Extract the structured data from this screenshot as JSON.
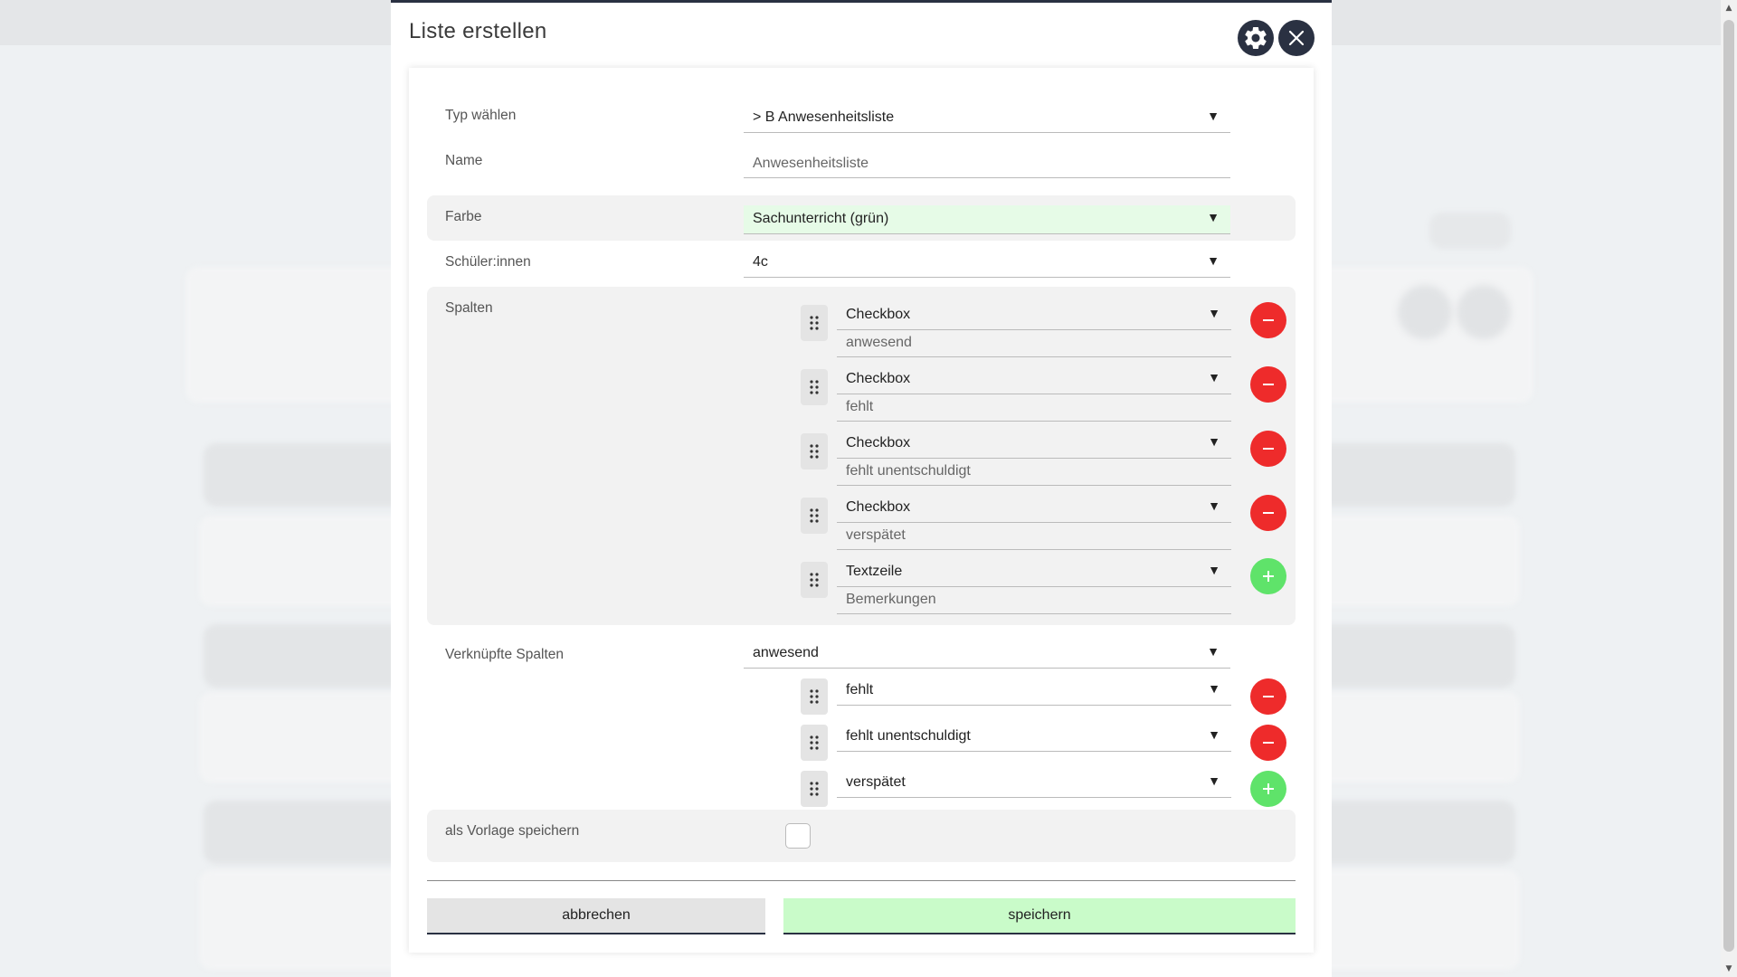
{
  "dialog": {
    "title": "Liste erstellen",
    "settings_icon": "gear-icon",
    "close_icon": "close-icon"
  },
  "form": {
    "type": {
      "label": "Typ wählen",
      "value": "> B Anwesenheitsliste"
    },
    "name": {
      "label": "Name",
      "value": "Anwesenheitsliste"
    },
    "color": {
      "label": "Farbe",
      "value": "Sachunterricht (grün)",
      "highlight": "#e6fbe7"
    },
    "students": {
      "label": "Schüler:innen",
      "value": "4c"
    },
    "columns": {
      "label": "Spalten",
      "items": [
        {
          "type": "Checkbox",
          "name": "anwesend",
          "action": "remove"
        },
        {
          "type": "Checkbox",
          "name": "fehlt",
          "action": "remove"
        },
        {
          "type": "Checkbox",
          "name": "fehlt unentschuldigt",
          "action": "remove"
        },
        {
          "type": "Checkbox",
          "name": "verspätet",
          "action": "remove"
        },
        {
          "type": "Textzeile",
          "name": "Bemerkungen",
          "action": "add"
        }
      ]
    },
    "linked_columns": {
      "label": "Verknüpfte Spalten",
      "primary": "anwesend",
      "items": [
        {
          "value": "fehlt",
          "action": "remove"
        },
        {
          "value": "fehlt unentschuldigt",
          "action": "remove"
        },
        {
          "value": "verspätet",
          "action": "add"
        }
      ]
    },
    "template": {
      "label": "als Vorlage speichern",
      "checked": false
    }
  },
  "footer": {
    "cancel_label": "abbrechen",
    "save_label": "speichern"
  },
  "colors": {
    "dark": "#2a3142",
    "remove": "#ee2b2b",
    "add": "#5fe36a",
    "save_bg": "#c9fbc9",
    "cancel_bg": "#e4e4e4"
  }
}
